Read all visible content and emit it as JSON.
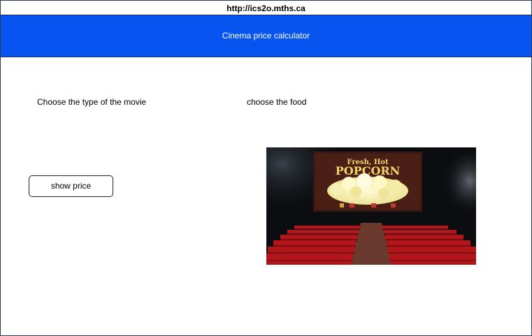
{
  "browser": {
    "url": "http://ics2o.mths.ca"
  },
  "header": {
    "title": "Cinema price calculator"
  },
  "main": {
    "movie_label": "Choose the type of the movie",
    "food_label": "choose the food",
    "show_price_label": "show price"
  },
  "image": {
    "screen_line1": "Fresh, Hot",
    "screen_line2": "POPCORN"
  },
  "colors": {
    "header_bg": "#0754f0",
    "header_text": "#ffffff",
    "seat_red": "#b3161a"
  }
}
